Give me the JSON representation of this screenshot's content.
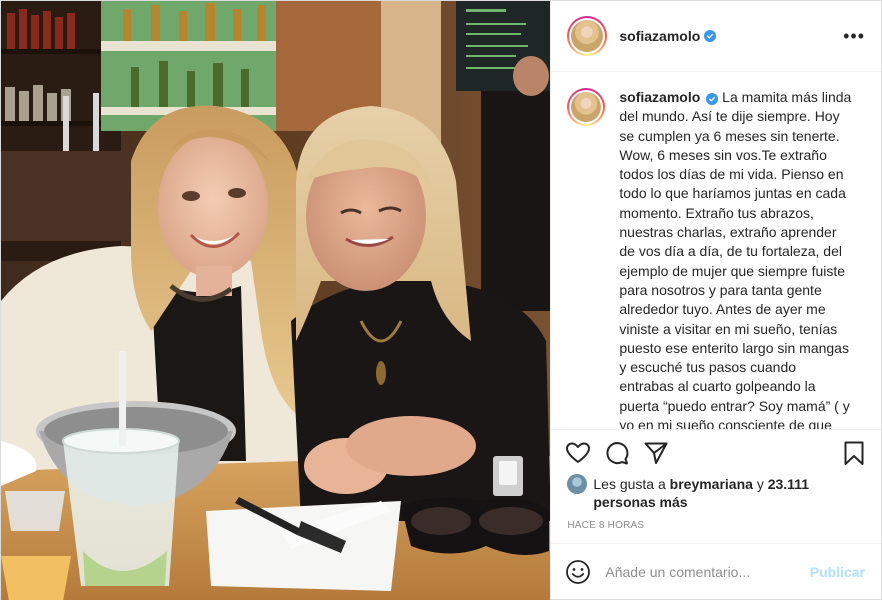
{
  "post": {
    "username": "sofiazamolo",
    "verified": true,
    "caption": "La mamita más linda del mundo. Así te dije siempre. Hoy se cumplen ya 6 meses sin tenerte. Wow, 6 meses sin vos.Te extraño todos los días de mi vida. Pienso en todo lo que haríamos juntas en cada momento. Extraño tus abrazos, nuestras charlas, extraño aprender de vos día a día, de tu fortaleza, del ejemplo de mujer que siempre fuiste para nosotros y para tanta gente alrededor tuyo. Antes de ayer me viniste a visitar en mi sueño, tenías puesto ese enterito largo sin mangas y escuché tus pasos cuando entrabas al cuarto golpeando la puerta “puedo entrar? Soy mamá” ( y yo en mi sueño consciente de que era solo un sueño, pensaba claro que podes entrar reina de mi alma, entra y",
    "likes": {
      "prefix": "Les gusta a",
      "user": "breymariana",
      "connector": "y",
      "others": "23.111 personas más"
    },
    "time": "HACE 8 HORAS"
  },
  "actions": {
    "icons": [
      "heart-icon",
      "comment-icon",
      "share-icon",
      "bookmark-icon"
    ]
  },
  "comment_box": {
    "placeholder": "Añade un comentario...",
    "publish_label": "Publicar"
  },
  "colors": {
    "verified_blue": "#3897f0",
    "publish_disabled": "#b2dffc",
    "muted_text": "#8e8e8e",
    "border": "#efefef"
  }
}
